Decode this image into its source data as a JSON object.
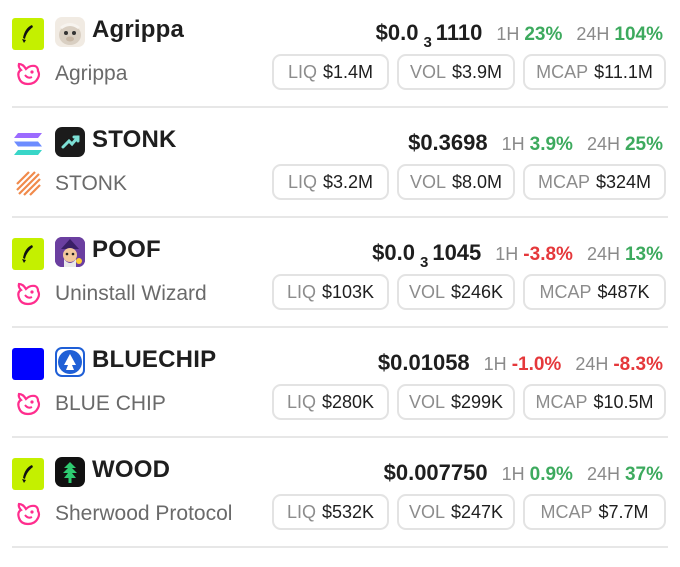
{
  "rows": [
    {
      "chain": "pump-fun-chain-icon",
      "dex": "uniswap-icon",
      "symbol": "Agrippa",
      "name": "Agrippa",
      "price": {
        "prefix": "$0.0",
        "sub": "3",
        "rest": "1110"
      },
      "h1": {
        "label": "1H",
        "value": "23%",
        "dir": "pos"
      },
      "h24": {
        "label": "24H",
        "value": "104%",
        "dir": "pos"
      },
      "liq": {
        "label": "LIQ",
        "value": "$1.4M"
      },
      "vol": {
        "label": "VOL",
        "value": "$3.9M"
      },
      "mcap": {
        "label": "MCAP",
        "value": "$11.1M"
      }
    },
    {
      "chain": "solana-chain-icon",
      "dex": "raydium-icon",
      "symbol": "STONK",
      "name": "STONK",
      "price": {
        "prefix": "$0.3698",
        "sub": "",
        "rest": ""
      },
      "h1": {
        "label": "1H",
        "value": "3.9%",
        "dir": "pos"
      },
      "h24": {
        "label": "24H",
        "value": "25%",
        "dir": "pos"
      },
      "liq": {
        "label": "LIQ",
        "value": "$3.2M"
      },
      "vol": {
        "label": "VOL",
        "value": "$8.0M"
      },
      "mcap": {
        "label": "MCAP",
        "value": "$324M"
      }
    },
    {
      "chain": "pump-fun-chain-icon",
      "dex": "uniswap-icon",
      "symbol": "POOF",
      "name": "Uninstall Wizard",
      "price": {
        "prefix": "$0.0",
        "sub": "3",
        "rest": "1045"
      },
      "h1": {
        "label": "1H",
        "value": "-3.8%",
        "dir": "neg"
      },
      "h24": {
        "label": "24H",
        "value": "13%",
        "dir": "pos"
      },
      "liq": {
        "label": "LIQ",
        "value": "$103K"
      },
      "vol": {
        "label": "VOL",
        "value": "$246K"
      },
      "mcap": {
        "label": "MCAP",
        "value": "$487K"
      }
    },
    {
      "chain": "base-chain-icon",
      "dex": "uniswap-icon",
      "symbol": "BLUECHIP",
      "name": "BLUE CHIP",
      "price": {
        "prefix": "$0.01058",
        "sub": "",
        "rest": ""
      },
      "h1": {
        "label": "1H",
        "value": "-1.0%",
        "dir": "neg"
      },
      "h24": {
        "label": "24H",
        "value": "-8.3%",
        "dir": "neg"
      },
      "liq": {
        "label": "LIQ",
        "value": "$280K"
      },
      "vol": {
        "label": "VOL",
        "value": "$299K"
      },
      "mcap": {
        "label": "MCAP",
        "value": "$10.5M"
      }
    },
    {
      "chain": "pump-fun-chain-icon",
      "dex": "uniswap-icon",
      "symbol": "WOOD",
      "name": "Sherwood Protocol",
      "price": {
        "prefix": "$0.007750",
        "sub": "",
        "rest": ""
      },
      "h1": {
        "label": "1H",
        "value": "0.9%",
        "dir": "pos"
      },
      "h24": {
        "label": "24H",
        "value": "37%",
        "dir": "pos"
      },
      "liq": {
        "label": "LIQ",
        "value": "$532K"
      },
      "vol": {
        "label": "VOL",
        "value": "$247K"
      },
      "mcap": {
        "label": "MCAP",
        "value": "$7.7M"
      }
    }
  ],
  "colors": {
    "positive": "#3daa5e",
    "negative": "#e5383b",
    "pump_chain_bg": "#c4f000",
    "base_chain_bg": "#0000ff",
    "uniswap_pink": "#ff2d8e"
  }
}
